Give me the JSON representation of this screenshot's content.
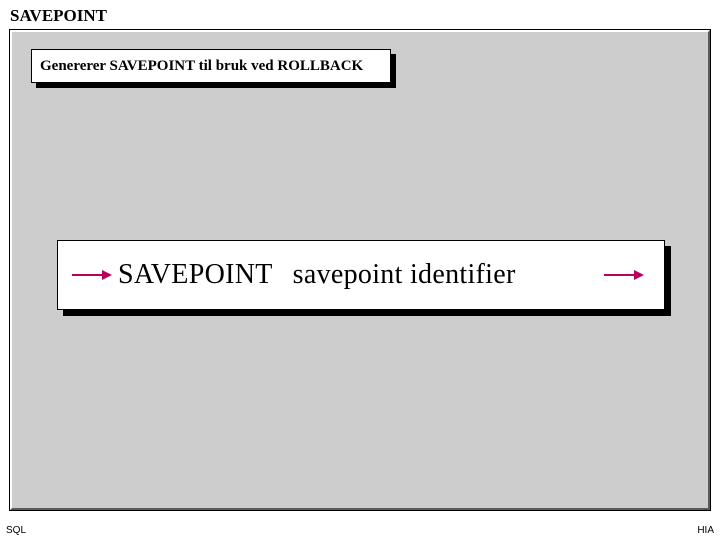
{
  "title": "SAVEPOINT",
  "description": "Genererer SAVEPOINT til bruk ved ROLLBACK",
  "syntax": {
    "keyword": "SAVEPOINT",
    "identifier": "savepoint identifier"
  },
  "footer": {
    "left": "SQL",
    "right": "HIA"
  }
}
